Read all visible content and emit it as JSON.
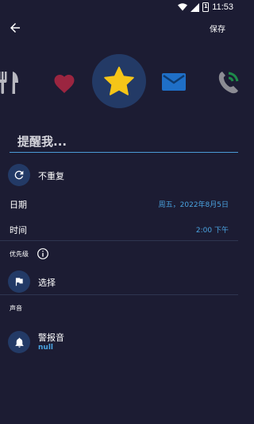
{
  "status_bar": {
    "time": "11:53",
    "battery_level_text": "1",
    "icons": [
      "wifi-icon",
      "signal-icon",
      "battery-icon"
    ]
  },
  "app_bar": {
    "back_icon": "arrow-left-icon",
    "save_label": "保存"
  },
  "category_icons": [
    {
      "name": "fork-knife-icon",
      "selected": false,
      "color": "#b8b8c0"
    },
    {
      "name": "heart-icon",
      "selected": false,
      "color": "#9b2540"
    },
    {
      "name": "star-icon",
      "selected": true,
      "color": "#f5c518"
    },
    {
      "name": "mail-icon",
      "selected": false,
      "color": "#1f6fc7"
    },
    {
      "name": "phone-icon",
      "selected": false,
      "color": "#1e8a4a"
    }
  ],
  "reminder": {
    "placeholder": "提醒我...",
    "value": ""
  },
  "repeat": {
    "icon": "repeat-icon",
    "label": "不重复"
  },
  "date": {
    "label": "日期",
    "value": "周五，2022年8月5日"
  },
  "time": {
    "label": "时间",
    "value": "2:00 下午"
  },
  "priority": {
    "label": "优先级",
    "info_icon": "info-icon",
    "choose_icon": "flag-icon",
    "choose_label": "选择"
  },
  "sound": {
    "section_label": "声音",
    "icon": "bell-icon",
    "label": "警报音",
    "value": "null"
  },
  "colors": {
    "background": "#1c1c33",
    "accent": "#4aa3e0",
    "circle_bg": "#233a66"
  }
}
